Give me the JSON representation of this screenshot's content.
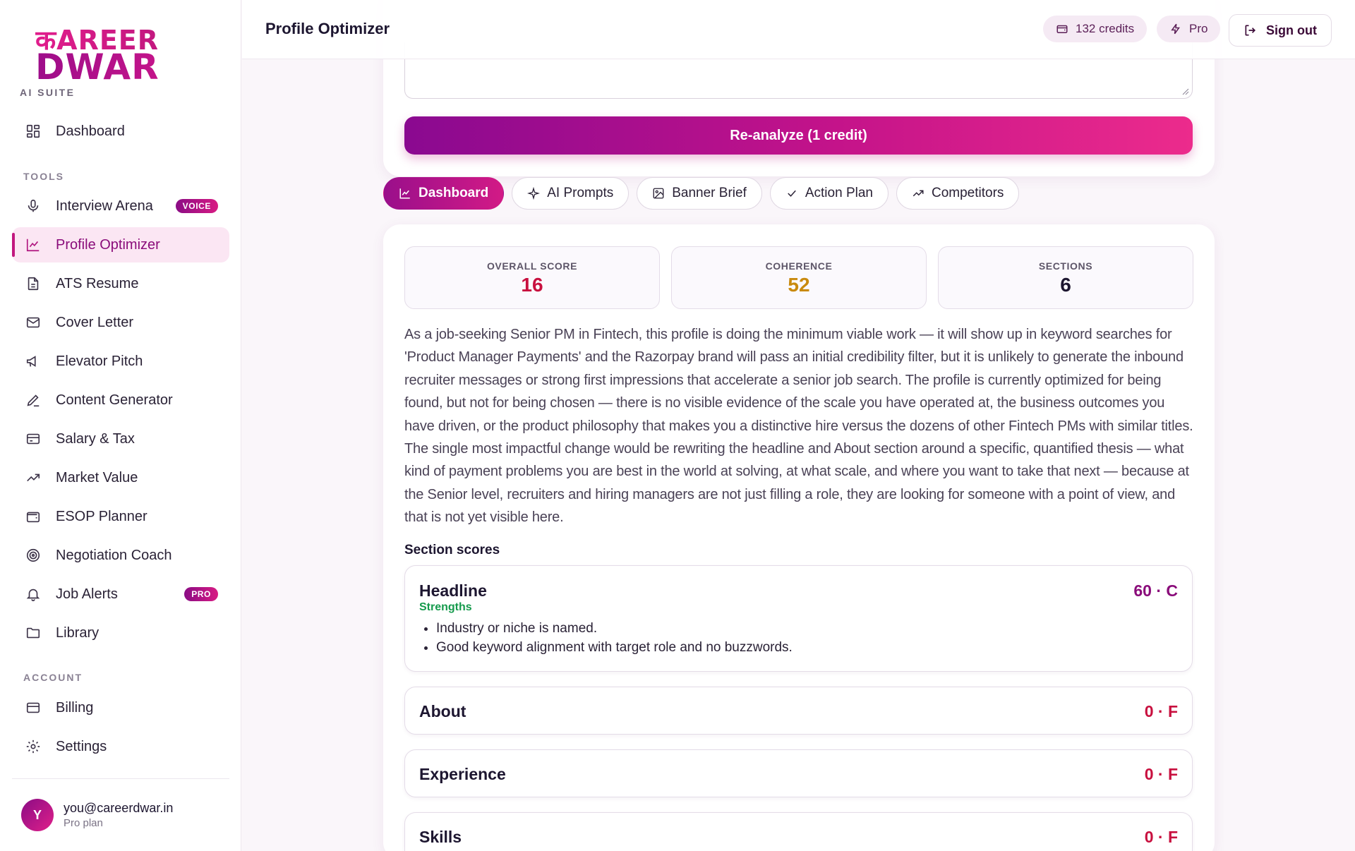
{
  "brand": {
    "logo_top": "कAREER",
    "logo_bottom": "DWAR",
    "suite": "AI SUITE"
  },
  "sidebar": {
    "dashboard": "Dashboard",
    "tools_label": "TOOLS",
    "tools": [
      {
        "label": "Interview Arena",
        "badge": "VOICE"
      },
      {
        "label": "Profile Optimizer"
      },
      {
        "label": "ATS Resume"
      },
      {
        "label": "Cover Letter"
      },
      {
        "label": "Elevator Pitch"
      },
      {
        "label": "Content Generator"
      },
      {
        "label": "Salary & Tax"
      },
      {
        "label": "Market Value"
      },
      {
        "label": "ESOP Planner"
      },
      {
        "label": "Negotiation Coach"
      },
      {
        "label": "Job Alerts",
        "badge": "PRO"
      },
      {
        "label": "Library"
      }
    ],
    "account_label": "ACCOUNT",
    "account": [
      {
        "label": "Billing"
      },
      {
        "label": "Settings"
      }
    ],
    "user": {
      "initial": "Y",
      "email": "you@careerdwar.in",
      "plan": "Pro plan"
    }
  },
  "header": {
    "title": "Profile Optimizer",
    "credits": "132 credits",
    "plan": "Pro",
    "signout": "Sign out"
  },
  "main": {
    "reanalyze_label": "Re-analyze (1 credit)",
    "tabs": [
      "Dashboard",
      "AI Prompts",
      "Banner Brief",
      "Action Plan",
      "Competitors"
    ],
    "stats": [
      {
        "label": "OVERALL SCORE",
        "value": "16",
        "color": "#c8103f"
      },
      {
        "label": "COHERENCE",
        "value": "52",
        "color": "#c98a0e"
      },
      {
        "label": "SECTIONS",
        "value": "6",
        "color": "#1d1630"
      }
    ],
    "summary": "As a job-seeking Senior PM in Fintech, this profile is doing the minimum viable work — it will show up in keyword searches for 'Product Manager Payments' and the Razorpay brand will pass an initial credibility filter, but it is unlikely to generate the inbound recruiter messages or strong first impressions that accelerate a senior job search. The profile is currently optimized for being found, but not for being chosen — there is no visible evidence of the scale you have operated at, the business outcomes you have driven, or the product philosophy that makes you a distinctive hire versus the dozens of other Fintech PMs with similar titles. The single most impactful change would be rewriting the headline and About section around a specific, quantified thesis — what kind of payment problems you are best in the world at solving, at what scale, and where you want to take that next — because at the Senior level, recruiters and hiring managers are not just filling a role, they are looking for someone with a point of view, and that is not yet visible here.",
    "section_scores_label": "Section scores",
    "sections": [
      {
        "name": "Headline",
        "score": "60 · C",
        "color": "#8a0c7a",
        "strengths_label": "Strengths",
        "strengths": [
          "Industry or niche is named.",
          "Good keyword alignment with target role and no buzzwords."
        ]
      },
      {
        "name": "About",
        "score": "0 · F",
        "color": "#c8103f"
      },
      {
        "name": "Experience",
        "score": "0 · F",
        "color": "#c8103f"
      },
      {
        "name": "Skills",
        "score": "0 · F",
        "color": "#c8103f"
      }
    ]
  }
}
